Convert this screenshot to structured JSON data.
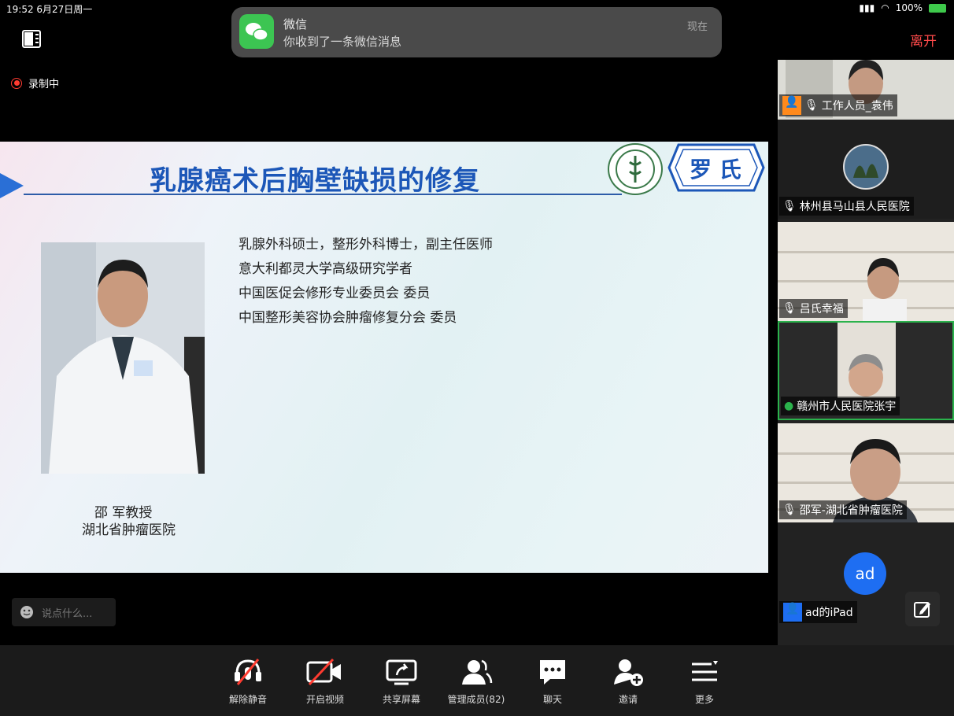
{
  "status_bar": {
    "time": "19:52  6月27日周一",
    "battery": "100%"
  },
  "topbar": {
    "leave_label": "离开"
  },
  "notification": {
    "app_name": "微信",
    "message": "你收到了一条微信消息",
    "time": "现在"
  },
  "recording": {
    "label": "录制中"
  },
  "slide": {
    "title": "乳腺癌术后胸壁缺损的修复",
    "badge": "罗 氏",
    "bio_lines": [
      "乳腺外科硕士，整形外科博士，副主任医师",
      "意大利都灵大学高级研究学者",
      "中国医促会修形专业委员会      委员",
      "中国整形美容协会肿瘤修复分会      委员"
    ],
    "caption_name": "邵    军教授",
    "caption_hospital": "湖北省肿瘤医院"
  },
  "chat_input": {
    "placeholder": "说点什么..."
  },
  "participants": [
    {
      "name": "工作人员_袁伟"
    },
    {
      "name": "林州县马山县人民医院"
    },
    {
      "name": "吕氏幸福"
    },
    {
      "name": "赣州市人民医院张宇"
    },
    {
      "name": "邵军-湖北省肿瘤医院"
    },
    {
      "name": "ad的iPad",
      "initials": "ad"
    }
  ],
  "toolbar": {
    "unmute": "解除静音",
    "start_video": "开启视频",
    "share_screen": "共享屏幕",
    "manage_members": "管理成员(82)",
    "chat": "聊天",
    "invite": "邀请",
    "more": "更多"
  },
  "colors": {
    "leave": "#ff4a4a",
    "slide_title": "#1c57b8",
    "active_speaker": "#2bb24c",
    "avatar_ad": "#1e6ef2"
  }
}
